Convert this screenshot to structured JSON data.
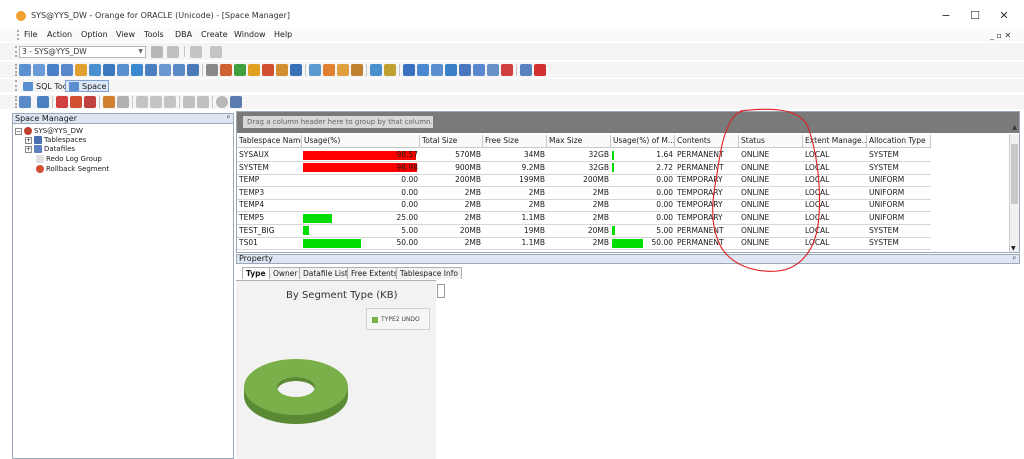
{
  "window": {
    "title": "SYS@YYS_DW - Orange for ORACLE (Unicode) - [Space Manager]",
    "minimize": "−",
    "maximize": "☐",
    "close": "✕"
  },
  "menu": {
    "items": [
      "File",
      "Action",
      "Option",
      "View",
      "Tools",
      "DBA",
      "Create",
      "Window",
      "Help"
    ],
    "mdi_controls": "_ ▫ ✕"
  },
  "toolbar": {
    "connection_value": "3 - SYS@YYS_DW",
    "sql_tool_label": "SQL Tool",
    "space_label": "Space"
  },
  "left_pane": {
    "title": "Space Manager",
    "pin": "ᵖ",
    "tree": {
      "root": "SYS@YYS_DW",
      "children": [
        "Tablespaces",
        "Datafiles",
        "Redo Log Group",
        "Rollback Segment"
      ]
    }
  },
  "grid": {
    "group_hint": "Drag a column header here to group by that column.",
    "columns": [
      "Tablespace Name",
      "Usage(%)",
      "Total Size",
      "Free Size",
      "Max Size",
      "Usage(%) of M...",
      "Contents",
      "Status",
      "Extent Manage...",
      "Allocation Type"
    ],
    "rows": [
      {
        "name": "SYSAUX",
        "usage": "98.57",
        "usage_pct": 98.57,
        "total": "570MB",
        "free": "34MB",
        "max": "32GB",
        "usage_max": "1.64",
        "usage_max_pct": 1.64,
        "contents": "PERMANENT",
        "status": "ONLINE",
        "extent": "LOCAL",
        "alloc": "SYSTEM"
      },
      {
        "name": "SYSTEM",
        "usage": "98.98",
        "usage_pct": 98.98,
        "total": "900MB",
        "free": "9.2MB",
        "max": "32GB",
        "usage_max": "2.72",
        "usage_max_pct": 2.72,
        "contents": "PERMANENT",
        "status": "ONLINE",
        "extent": "LOCAL",
        "alloc": "SYSTEM"
      },
      {
        "name": "TEMP",
        "usage": "0.00",
        "usage_pct": 0,
        "total": "200MB",
        "free": "199MB",
        "max": "200MB",
        "usage_max": "0.00",
        "usage_max_pct": 0,
        "contents": "TEMPORARY",
        "status": "ONLINE",
        "extent": "LOCAL",
        "alloc": "UNIFORM"
      },
      {
        "name": "TEMP3",
        "usage": "0.00",
        "usage_pct": 0,
        "total": "2MB",
        "free": "2MB",
        "max": "2MB",
        "usage_max": "0.00",
        "usage_max_pct": 0,
        "contents": "TEMPORARY",
        "status": "ONLINE",
        "extent": "LOCAL",
        "alloc": "UNIFORM"
      },
      {
        "name": "TEMP4",
        "usage": "0.00",
        "usage_pct": 0,
        "total": "2MB",
        "free": "2MB",
        "max": "2MB",
        "usage_max": "0.00",
        "usage_max_pct": 0,
        "contents": "TEMPORARY",
        "status": "ONLINE",
        "extent": "LOCAL",
        "alloc": "UNIFORM"
      },
      {
        "name": "TEMP5",
        "usage": "25.00",
        "usage_pct": 25,
        "total": "2MB",
        "free": "1.1MB",
        "max": "2MB",
        "usage_max": "0.00",
        "usage_max_pct": 0,
        "contents": "TEMPORARY",
        "status": "ONLINE",
        "extent": "LOCAL",
        "alloc": "UNIFORM"
      },
      {
        "name": "TEST_BIG",
        "usage": "5.00",
        "usage_pct": 5,
        "total": "20MB",
        "free": "19MB",
        "max": "20MB",
        "usage_max": "5.00",
        "usage_max_pct": 5,
        "contents": "PERMANENT",
        "status": "ONLINE",
        "extent": "LOCAL",
        "alloc": "SYSTEM"
      },
      {
        "name": "TS01",
        "usage": "50.00",
        "usage_pct": 50,
        "total": "2MB",
        "free": "1.1MB",
        "max": "2MB",
        "usage_max": "50.00",
        "usage_max_pct": 50,
        "contents": "PERMANENT",
        "status": "ONLINE",
        "extent": "LOCAL",
        "alloc": "SYSTEM"
      }
    ]
  },
  "property": {
    "title": "Property",
    "tabs": [
      "Type",
      "Owner",
      "Datafile List",
      "Free Extents",
      "Tablespace Info"
    ],
    "active_tab": "Type"
  },
  "chart_data": {
    "type": "pie",
    "title": "By Segment Type (KB)",
    "categories": [
      "TYPE2 UNDO"
    ],
    "values": [
      100
    ],
    "style": "3d-donut",
    "colors": [
      "#7ab04a"
    ]
  },
  "colors": {
    "bar_high": "#ff0000",
    "bar_normal": "#00dd00",
    "annotation": "#e02020",
    "header_bg": "#dde6f2"
  }
}
